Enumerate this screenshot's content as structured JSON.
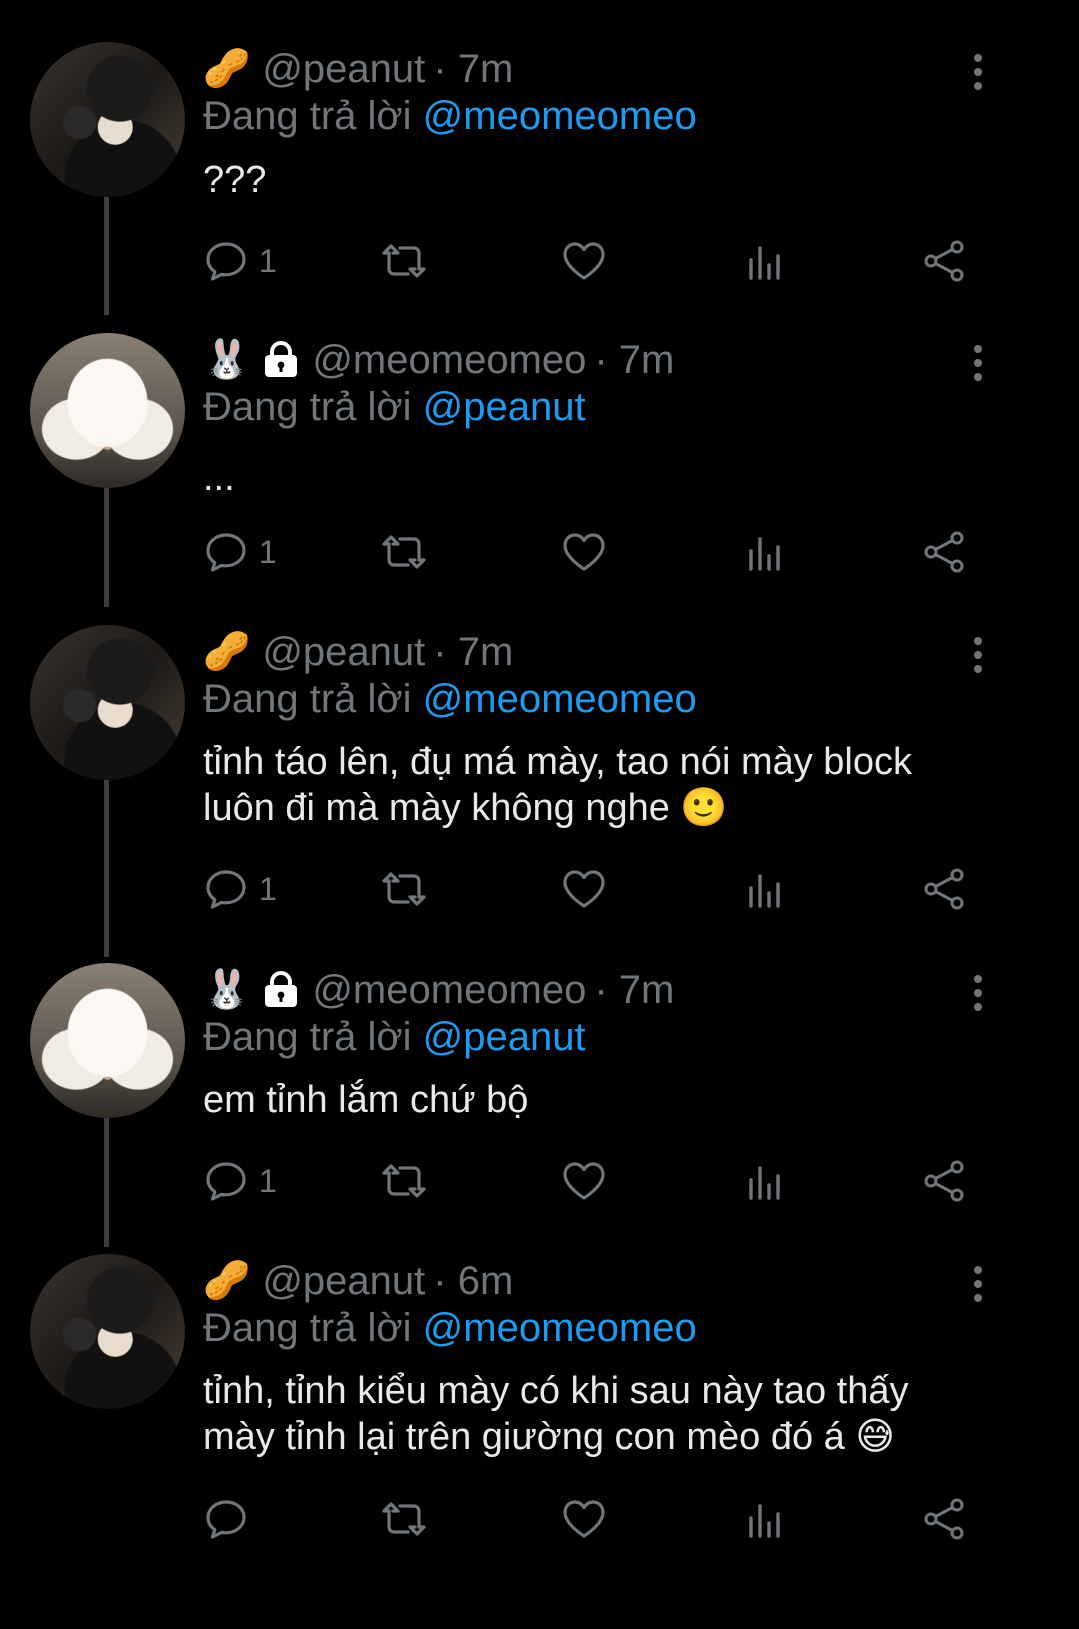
{
  "tweets": [
    {
      "user_emoji": "🥜",
      "handle": "@peanut",
      "time": "· 7m",
      "locked": false,
      "reply_prefix": "Đang trả lời",
      "reply_to": "@meomeomeo",
      "text": "???",
      "reply_count": "1",
      "avatar": "peanut-avatar"
    },
    {
      "user_emoji": "🐰",
      "handle": "@meomeomeo",
      "time": "· 7m",
      "locked": true,
      "reply_prefix": "Đang trả lời",
      "reply_to": "@peanut",
      "text": "...",
      "reply_count": "1",
      "avatar": "bunny-avatar"
    },
    {
      "user_emoji": "🥜",
      "handle": "@peanut",
      "time": "· 7m",
      "locked": false,
      "reply_prefix": "Đang trả lời",
      "reply_to": "@meomeomeo",
      "text_line1": "tỉnh táo lên, đụ má mày, tao nói mày block",
      "text_line2": "luôn đi mà mày không nghe 🙂",
      "reply_count": "1",
      "avatar": "peanut-avatar"
    },
    {
      "user_emoji": "🐰",
      "handle": "@meomeomeo",
      "time": "· 7m",
      "locked": true,
      "reply_prefix": "Đang trả lời",
      "reply_to": "@peanut",
      "text": "em tỉnh lắm chứ bộ",
      "reply_count": "1",
      "avatar": "bunny-avatar"
    },
    {
      "user_emoji": "🥜",
      "handle": "@peanut",
      "time": "· 6m",
      "locked": false,
      "reply_prefix": "Đang trả lời",
      "reply_to": "@meomeomeo",
      "text_line1": "tỉnh, tỉnh kiểu mày có khi sau này tao thấy",
      "text_line2": "mày tỉnh lại trên giường con mèo đó á 😅",
      "reply_count": "",
      "avatar": "peanut-avatar"
    }
  ],
  "icons": {
    "reply": "reply-icon",
    "retweet": "retweet-icon",
    "like": "heart-icon",
    "views": "views-icon",
    "share": "share-icon",
    "more": "more-vertical-icon",
    "lock": "lock-icon"
  },
  "colors": {
    "background": "#000000",
    "text": "#e7e9ea",
    "secondary": "#71767b",
    "mention": "#1d9bf0",
    "thread_line": "#3a3d41"
  }
}
